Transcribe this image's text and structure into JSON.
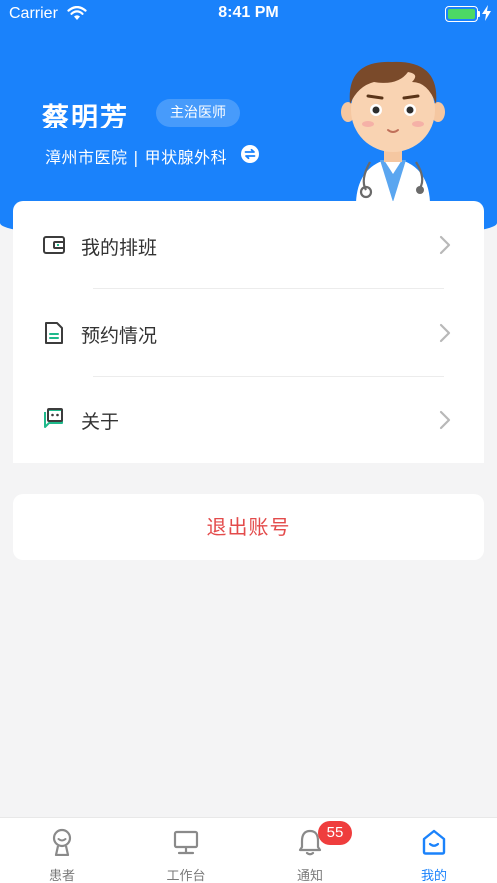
{
  "status_bar": {
    "carrier": "Carrier",
    "time": "8:41 PM"
  },
  "profile": {
    "name": "蔡明芳",
    "title": "主治医师",
    "hospital_line": "漳州市医院 | 甲状腺外科"
  },
  "menu": [
    {
      "label": "我的排班",
      "icon": "wallet-icon"
    },
    {
      "label": "预约情况",
      "icon": "document-icon"
    },
    {
      "label": "关于",
      "icon": "chat-icon"
    }
  ],
  "logout": {
    "label": "退出账号"
  },
  "tabs": [
    {
      "label": "患者",
      "icon": "patient-icon",
      "active": false
    },
    {
      "label": "工作台",
      "icon": "monitor-icon",
      "active": false
    },
    {
      "label": "通知",
      "icon": "bell-icon",
      "active": false,
      "badge": "55"
    },
    {
      "label": "我的",
      "icon": "home-icon",
      "active": true
    }
  ],
  "colors": {
    "primary": "#1a82fb",
    "danger": "#e34b4b",
    "accent_green": "#1fb98b",
    "badge": "#ef3d3d"
  }
}
